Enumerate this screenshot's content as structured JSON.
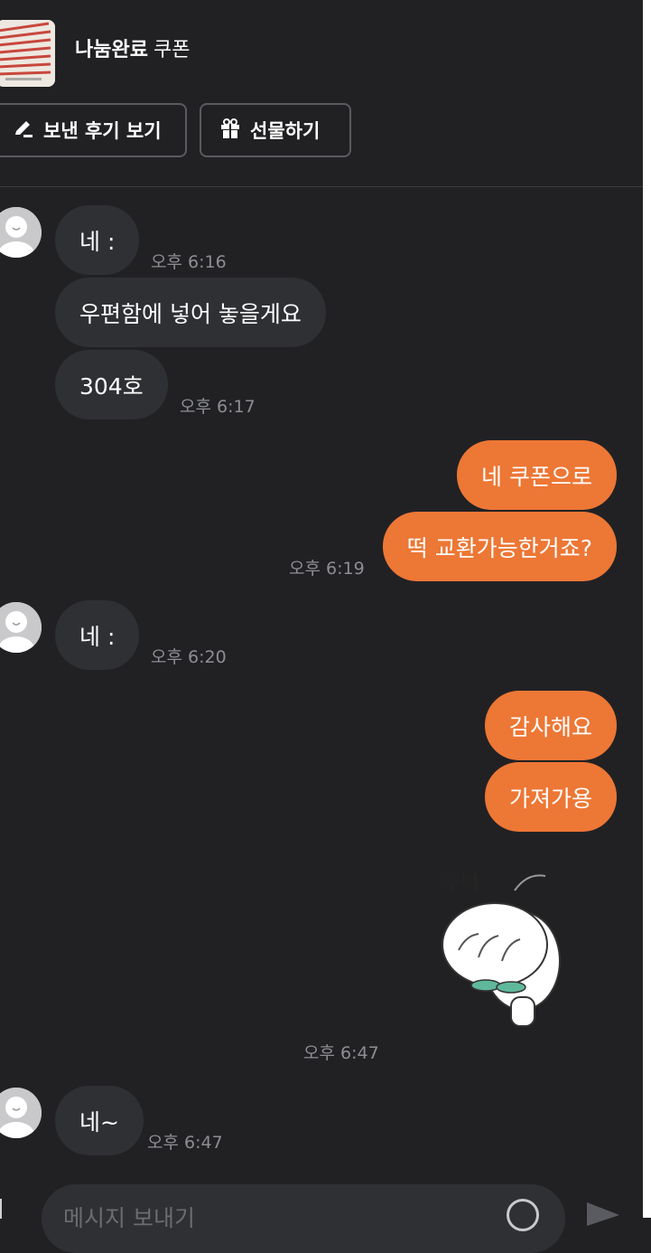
{
  "header": {
    "status": "나눔완료",
    "product_title": "쿠폰",
    "review_button": "보낸 후기 보기",
    "gift_button": "선물하기"
  },
  "messages": [
    {
      "from": "other",
      "text": "네 :",
      "time": "오후 6:16"
    },
    {
      "from": "other",
      "text": "우편함에 넣어 놓을게요",
      "time": ""
    },
    {
      "from": "other",
      "text": "304호",
      "time": "오후 6:17"
    },
    {
      "from": "me",
      "text": "네 쿠폰으로",
      "time": ""
    },
    {
      "from": "me",
      "text": "떡 교환가능한거죠?",
      "time": "오후 6:19"
    },
    {
      "from": "other",
      "text": "네 :",
      "time": "오후 6:20"
    },
    {
      "from": "me",
      "text": "감사해요",
      "time": ""
    },
    {
      "from": "me",
      "text": "가져가용",
      "time": ""
    },
    {
      "from": "me",
      "sticker": "bowing-sticker",
      "sticker_text": "꾸벅",
      "time": "오후 6:47"
    },
    {
      "from": "other",
      "text": "네~",
      "time": "오후 6:47"
    }
  ],
  "input": {
    "placeholder": "메시지 보내기",
    "plus_icon": "plus-icon",
    "emoji_icon": "emoji-icon",
    "send_icon": "send-icon"
  },
  "colors": {
    "background": "#212124",
    "bubble_in": "#2f3034",
    "bubble_out": "#ed7735",
    "time": "#8d8e93"
  }
}
